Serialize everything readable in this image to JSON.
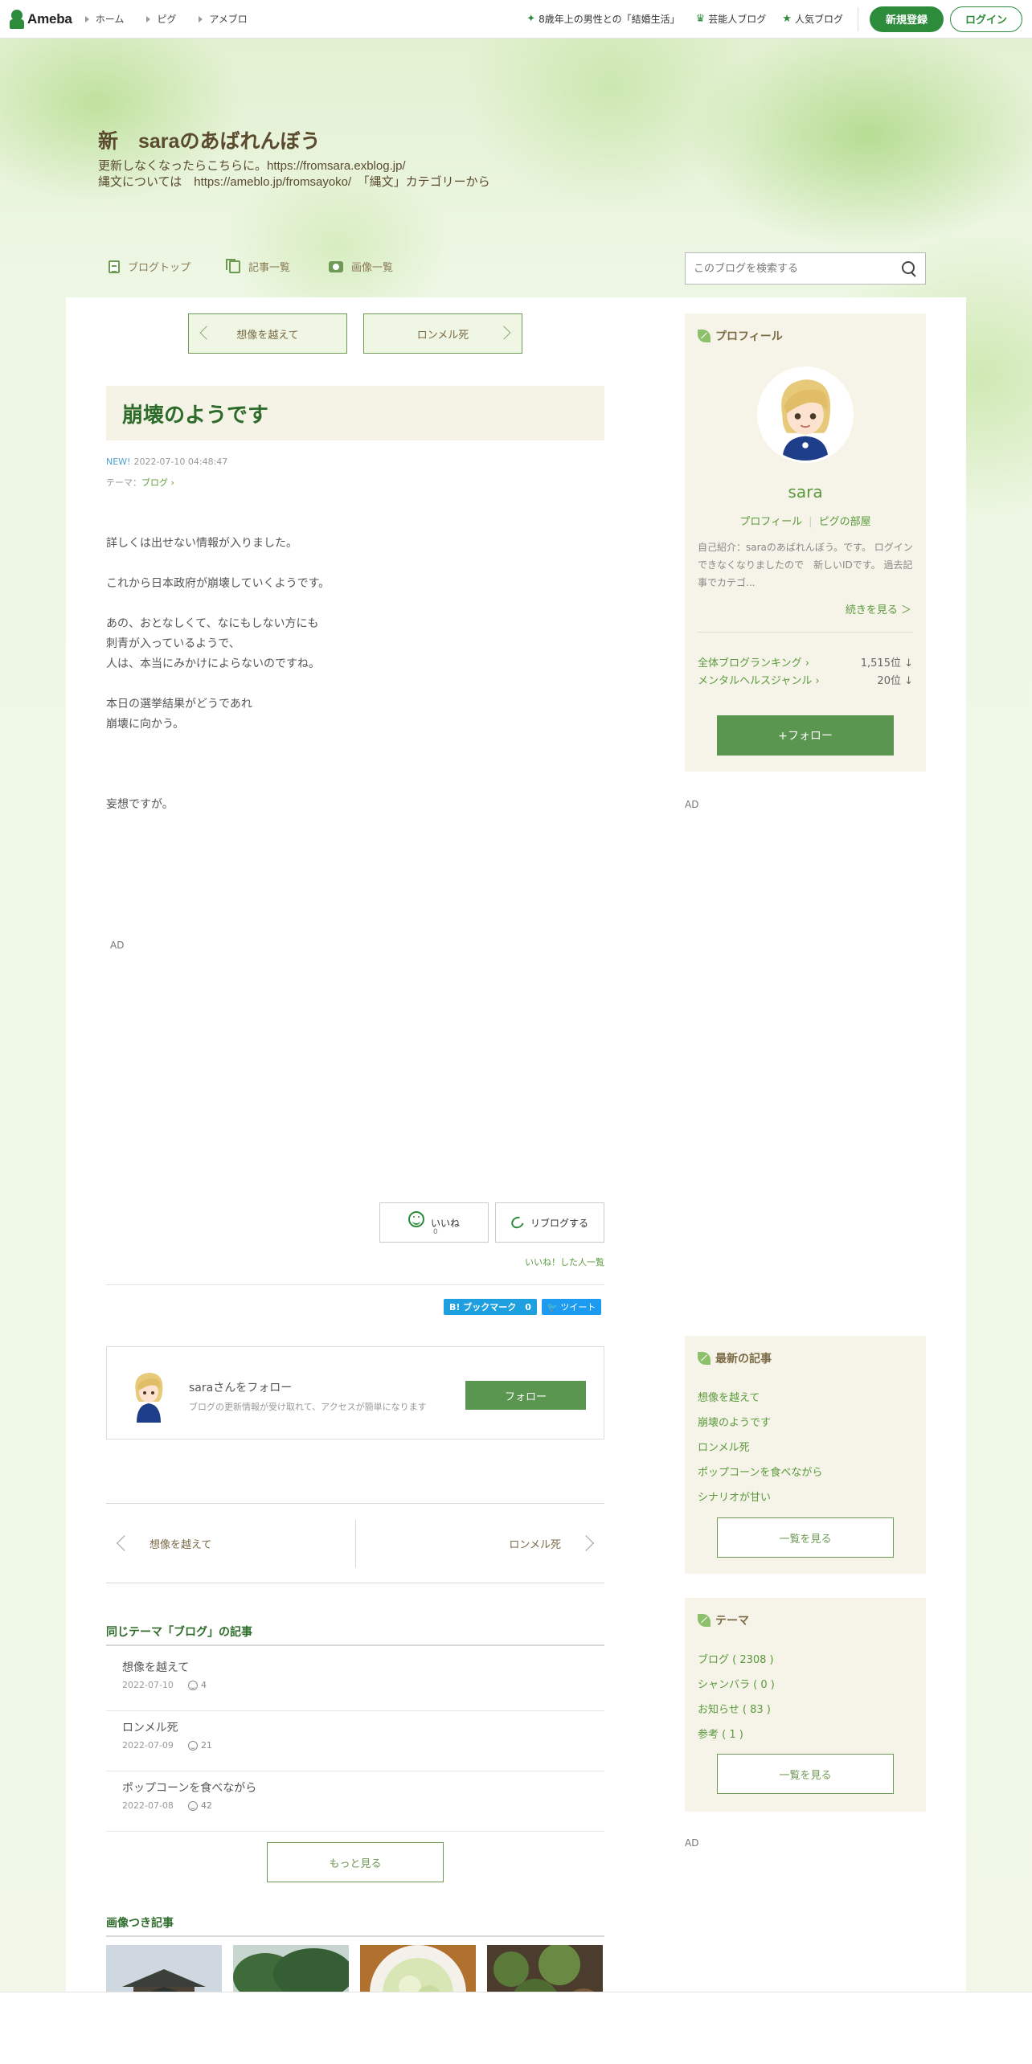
{
  "header": {
    "logo": "Ameba",
    "nav": [
      "ホーム",
      "ピグ",
      "アメブロ"
    ],
    "right_links": [
      "8歳年上の男性との「結婚生活」",
      "芸能人ブログ",
      "人気ブログ"
    ],
    "signup": "新規登録",
    "login": "ログイン"
  },
  "blog": {
    "title": "新　saraのあばれんぼう",
    "desc_line1": "更新しなくなったらこちらに。https://fromsara.exblog.jp/",
    "desc_line2": "縄文については　https://ameblo.jp/fromsayoko/　「縄文」カテゴリーから",
    "nav": [
      "ブログトップ",
      "記事一覧",
      "画像一覧"
    ],
    "search_placeholder": "このブログを検索する"
  },
  "entry": {
    "prev_top": "想像を越えて",
    "next_top": "ロンメル死",
    "title": "崩壊のようです",
    "new_label": "NEW!",
    "datetime": "2022-07-10 04:48:47",
    "theme_label": "テーマ：",
    "theme": "ブログ",
    "body": [
      "詳しくは出せない情報が入りました。",
      "これから日本政府が崩壊していくようです。",
      "あの、おとなしくて、なにもしない方にも\n刺青が入っているようで、\n人は、本当にみかけによらないのですね。",
      "本日の選挙結果がどうであれ\n崩壊に向かう。",
      "",
      "妄想ですが。"
    ],
    "ad_label": "AD",
    "iine_label": "いいね",
    "iine_count": "0",
    "reblog_label": "リブログする",
    "iine_list": "いいね！した人一覧",
    "hatena": "B! ブックマーク　0",
    "tweet": "ツイート"
  },
  "follow_box": {
    "name": "saraさんをフォロー",
    "sub": "ブログの更新情報が受け取れて、アクセスが簡単になります",
    "button": "フォロー"
  },
  "pager": {
    "prev": "想像を越えて",
    "next": "ロンメル死"
  },
  "same_theme": {
    "heading": "同じテーマ「ブログ」の記事",
    "items": [
      {
        "title": "想像を越えて",
        "date": "2022-07-10",
        "likes": "4"
      },
      {
        "title": "ロンメル死",
        "date": "2022-07-09",
        "likes": "21"
      },
      {
        "title": "ポップコーンを食べながら",
        "date": "2022-07-08",
        "likes": "42"
      }
    ],
    "more": "もっと見る"
  },
  "image_articles": {
    "heading": "画像つき記事"
  },
  "sidebar": {
    "profile": {
      "heading": "プロフィール",
      "name": "sara",
      "link1": "プロフィール",
      "link2": "ピグの部屋",
      "intro": "自己紹介：saraのあばれんぼう。です。 ログインできなくなりましたので　新しいIDです。 過去記事でカテゴ...",
      "more": "続きを見る ＞",
      "rank1_label": "全体ブログランキング",
      "rank1_value": "1,515位 ↓",
      "rank2_label": "メンタルヘルスジャンル",
      "rank2_value": "20位 ↓",
      "follow": "+フォロー"
    },
    "ad_label": "AD",
    "recent": {
      "heading": "最新の記事",
      "items": [
        "想像を越えて",
        "崩壊のようです",
        "ロンメル死",
        "ポップコーンを食べながら",
        "シナリオが甘い"
      ],
      "button": "一覧を見る"
    },
    "themes": {
      "heading": "テーマ",
      "items": [
        "ブログ ( 2308 )",
        "シャンバラ ( 0 )",
        "お知らせ ( 83 )",
        "参考 ( 1 )"
      ],
      "button": "一覧を見る"
    }
  }
}
